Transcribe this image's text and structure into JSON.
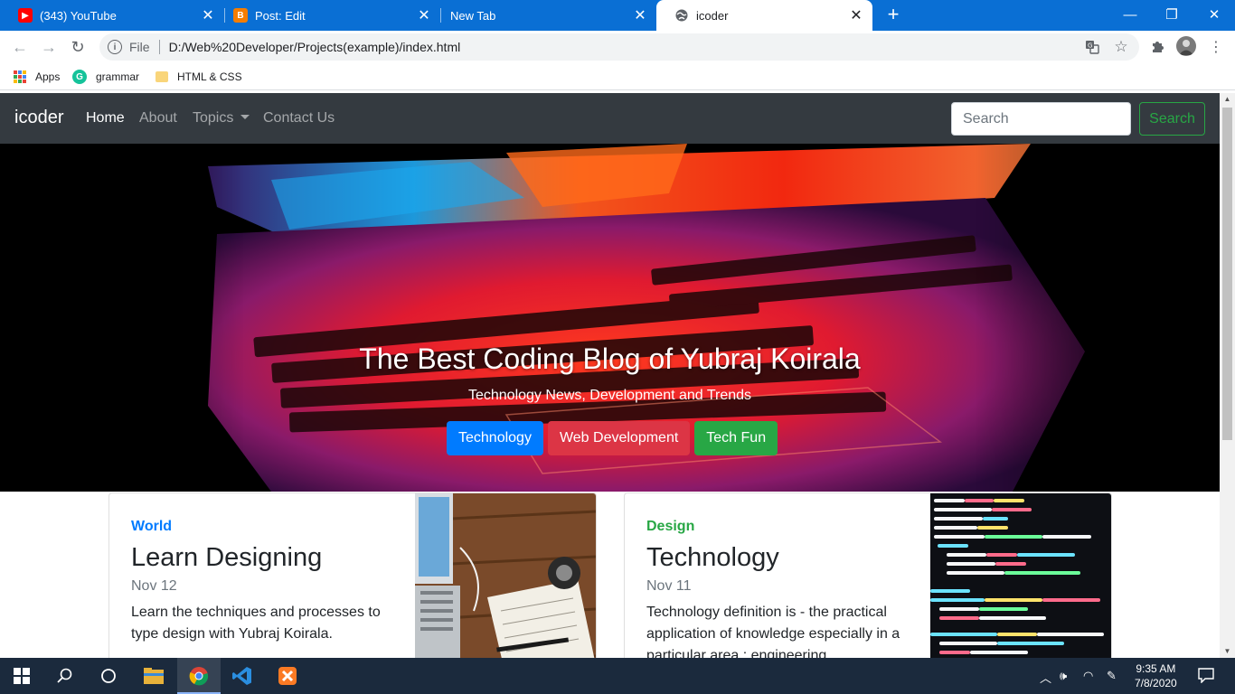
{
  "browser": {
    "tabs": [
      {
        "title": "(343) YouTube",
        "icon": "youtube-icon"
      },
      {
        "title": "Post: Edit",
        "icon": "blogger-icon"
      },
      {
        "title": "New Tab",
        "icon": ""
      },
      {
        "title": "icoder",
        "icon": "globe-icon"
      }
    ],
    "active_tab": 3,
    "scheme_label": "File",
    "url": "D:/Web%20Developer/Projects(example)/index.html",
    "bookmarks": [
      {
        "label": "Apps",
        "icon": "apps-grid-icon"
      },
      {
        "label": "grammar",
        "icon": "grammarly-icon"
      },
      {
        "label": "HTML & CSS",
        "icon": "folder-icon"
      }
    ]
  },
  "site": {
    "brand": "icoder",
    "nav": [
      {
        "label": "Home",
        "active": true
      },
      {
        "label": "About",
        "active": false
      },
      {
        "label": "Topics",
        "active": false,
        "dropdown": true
      },
      {
        "label": "Contact Us",
        "active": false
      }
    ],
    "search": {
      "placeholder": "Search",
      "button": "Search"
    },
    "hero": {
      "title": "The Best Coding Blog of Yubraj Koirala",
      "subtitle": "Technology News, Development and Trends",
      "buttons": [
        {
          "label": "Technology",
          "color": "#007bff"
        },
        {
          "label": "Web Development",
          "color": "#dc3545"
        },
        {
          "label": "Tech Fun",
          "color": "#28a745"
        }
      ]
    },
    "cards": [
      {
        "category": "World",
        "category_color": "#007bff",
        "title": "Learn Designing",
        "date": "Nov 12",
        "text": "Learn the techniques and processes to type design with Yubraj Koirala."
      },
      {
        "category": "Design",
        "category_color": "#28a745",
        "title": "Technology",
        "date": "Nov 11",
        "text": "Technology definition is - the practical application of knowledge especially in a particular area : engineering."
      }
    ]
  },
  "taskbar": {
    "time": "9:35 AM",
    "date": "7/8/2020"
  }
}
